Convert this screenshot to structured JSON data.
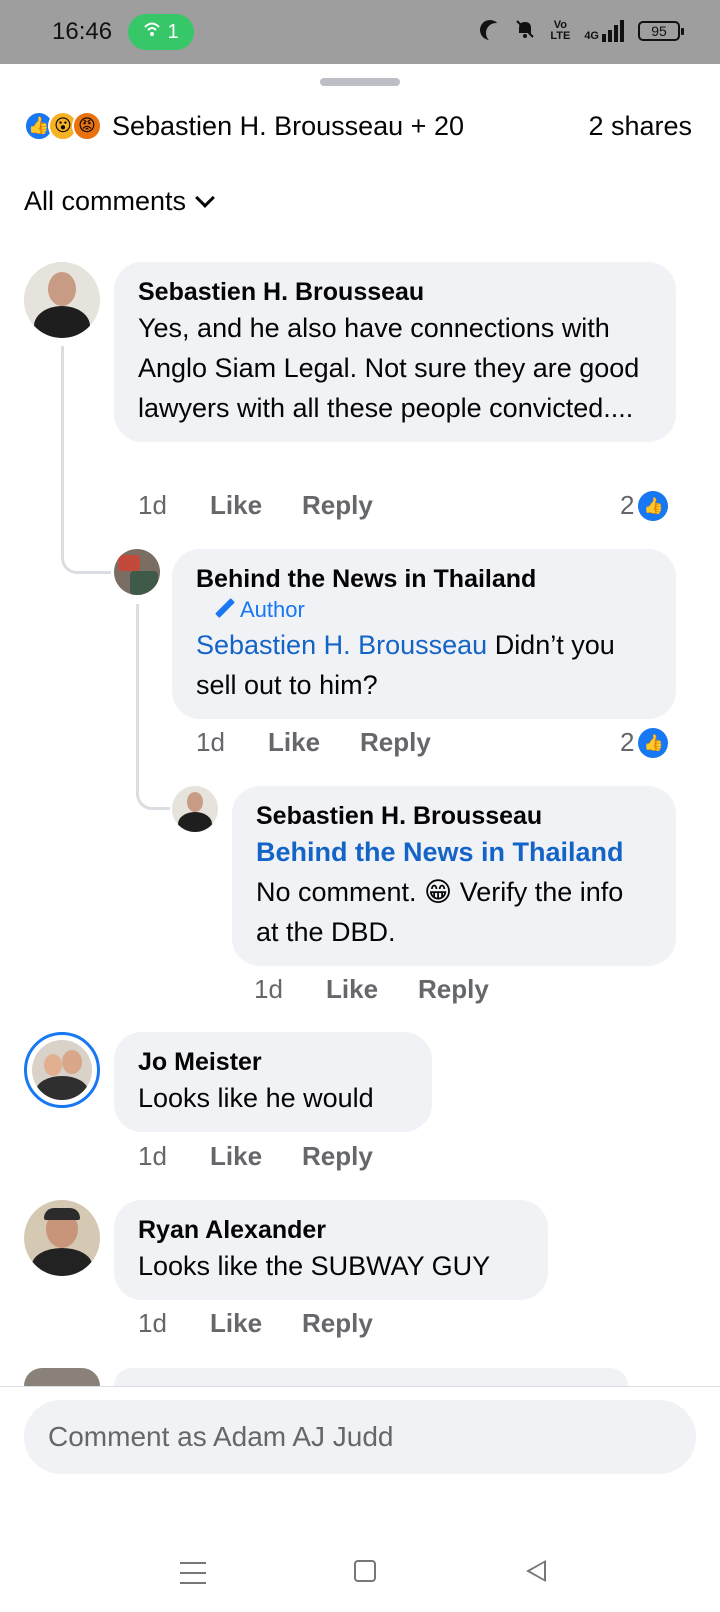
{
  "status_bar": {
    "time": "16:46",
    "hotspot_count": "1",
    "battery": "95",
    "network_top": "Vo",
    "network_bottom": "LTE",
    "signal_label": "4G"
  },
  "post_summary": {
    "reactors": "Sebastien H. Brousseau + 20",
    "shares": "2 shares",
    "reaction_icons": [
      "like-icon",
      "wow-icon",
      "angry-icon"
    ]
  },
  "filter": {
    "label": "All comments"
  },
  "comments": [
    {
      "name": "Sebastien H. Brousseau",
      "text": "Yes, and he also have connections with Anglo Siam Legal. Not sure they are good lawyers with all these people convicted....",
      "time": "1d",
      "like": "Like",
      "reply": "Reply",
      "like_count": "2"
    },
    {
      "name": "Behind the News in Thailand",
      "badge": "Author",
      "mention": "Sebastien H. Brousseau",
      "text": " Didn’t you sell out to him?",
      "time": "1d",
      "like": "Like",
      "reply": "Reply",
      "like_count": "2"
    },
    {
      "name": "Sebastien H. Brousseau",
      "mention": "Behind the News in Thailand",
      "text": "No comment. 😁 Verify the info at the DBD.",
      "time": "1d",
      "like": "Like",
      "reply": "Reply"
    },
    {
      "name": "Jo Meister",
      "text": "Looks like he would",
      "time": "1d",
      "like": "Like",
      "reply": "Reply"
    },
    {
      "name": "Ryan Alexander",
      "text": "Looks like the SUBWAY GUY",
      "time": "1d",
      "like": "Like",
      "reply": "Reply"
    }
  ],
  "composer": {
    "placeholder": "Comment as Adam AJ Judd"
  },
  "colors": {
    "accent": "#1877f2",
    "bubble": "#f0f2f5",
    "meta_text": "#65676b",
    "status_bar": "#9e9e9e",
    "hotspot": "#37c768"
  }
}
